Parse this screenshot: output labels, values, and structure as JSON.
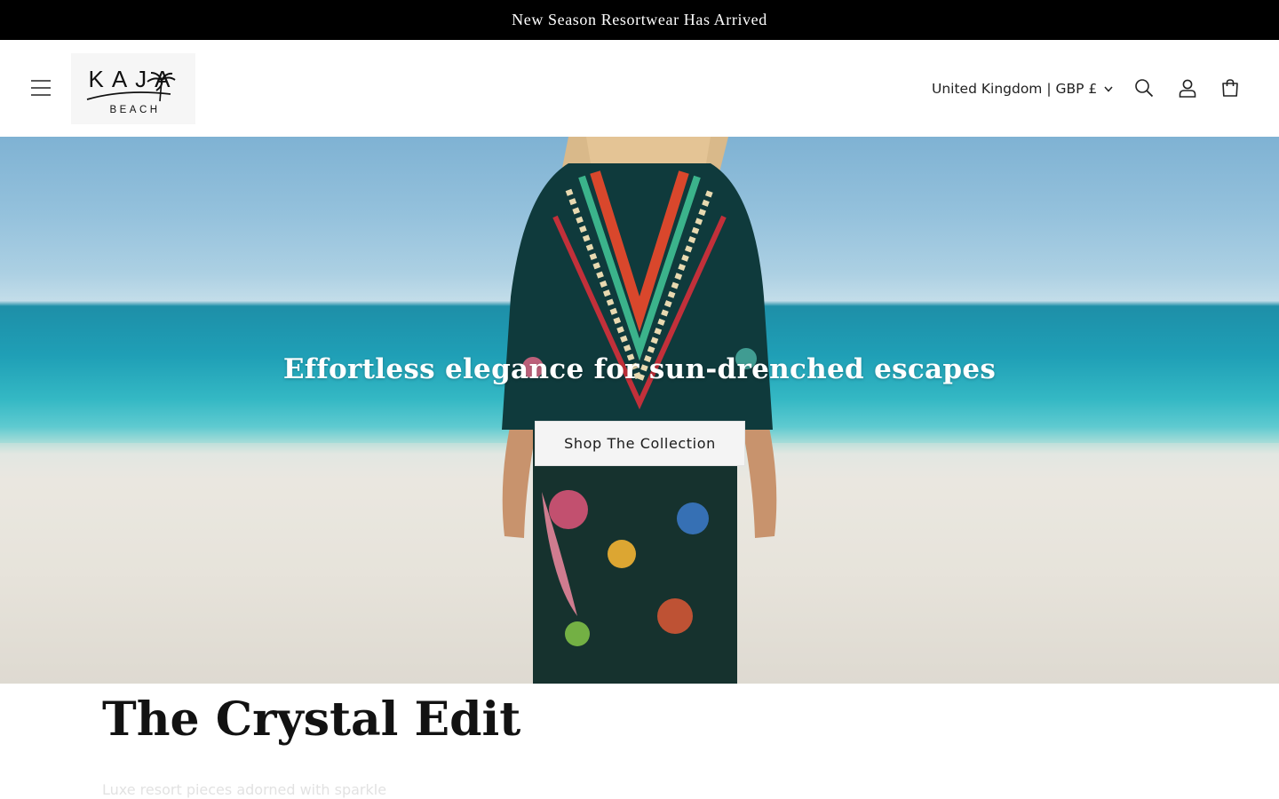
{
  "announcement": {
    "text": "New Season Resortwear Has Arrived"
  },
  "header": {
    "logo": {
      "line1": "KAJA",
      "line2": "BEACH"
    },
    "country_selector": {
      "label": "United Kingdom | GBP £"
    },
    "icons": [
      "menu-icon",
      "search-icon",
      "account-icon",
      "cart-icon"
    ]
  },
  "hero": {
    "title": "Effortless elegance for sun-drenched escapes",
    "cta_label": "Shop The Collection"
  },
  "collection": {
    "title": "The Crystal Edit",
    "subtitle": "Luxe resort pieces adorned with sparkle"
  },
  "colors": {
    "announcement_bg": "#000000",
    "text": "#121212",
    "button_bg": "#f4f4f4"
  }
}
